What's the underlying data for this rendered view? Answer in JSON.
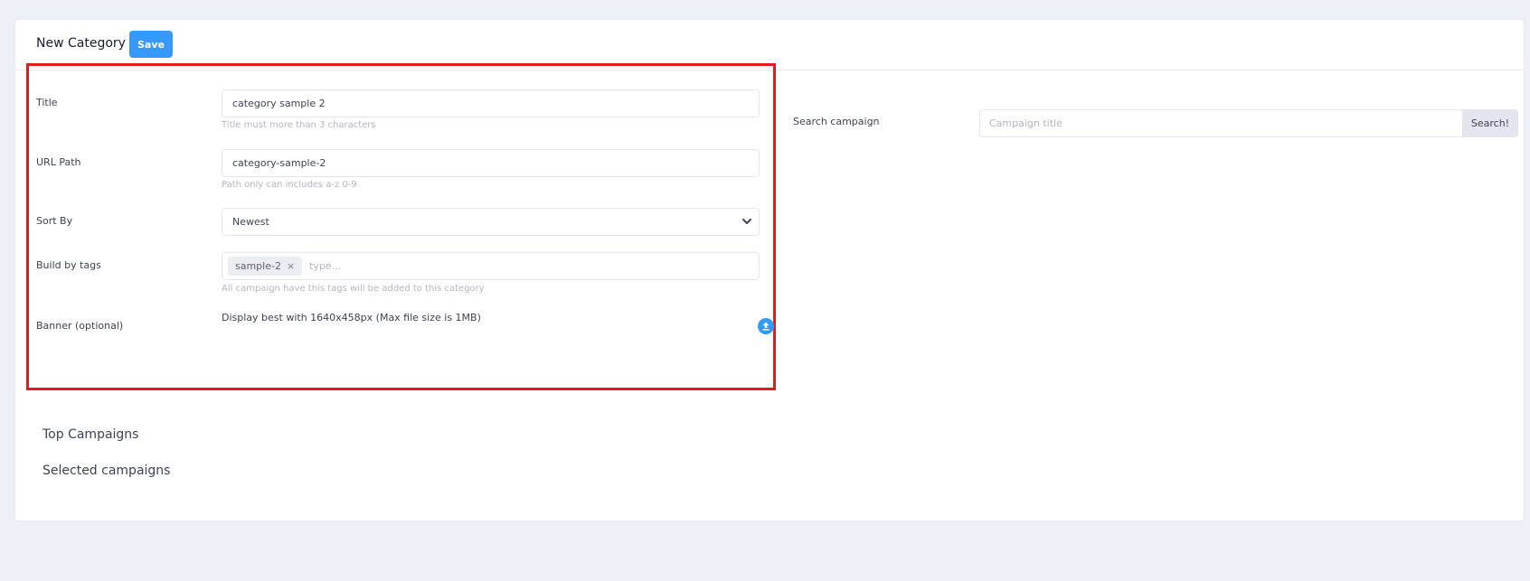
{
  "header": {
    "title": "New Category",
    "save_label": "Save"
  },
  "form": {
    "title": {
      "label": "Title",
      "value": "category sample 2",
      "help": "Title must more than 3 characters"
    },
    "url_path": {
      "label": "URL Path",
      "value": "category-sample-2",
      "help": "Path only can includes a-z 0-9"
    },
    "sort_by": {
      "label": "Sort By",
      "selected": "Newest"
    },
    "build_by_tags": {
      "label": "Build by tags",
      "tags": [
        "sample-2"
      ],
      "remove_glyph": "×",
      "placeholder": "type...",
      "help": "All campaign have this tags will be added to this category"
    },
    "banner": {
      "label": "Banner (optional)",
      "hint": "Display best with 1640x458px (Max file size is 1MB)",
      "icon": "upload-icon"
    }
  },
  "search": {
    "label": "Search campaign",
    "placeholder": "Campaign title",
    "button_label": "Search!"
  },
  "sections": {
    "top_campaigns": "Top Campaigns",
    "selected_campaigns": "Selected campaigns"
  },
  "colors": {
    "accent": "#3699ff",
    "highlight": "#e31b1b",
    "page_bg": "#eef0f8"
  }
}
